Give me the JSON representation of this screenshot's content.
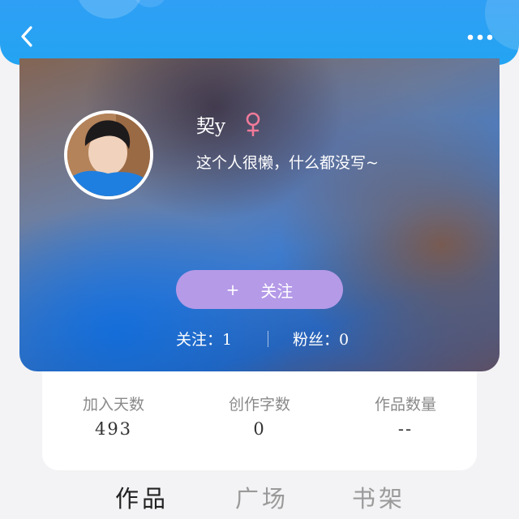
{
  "header": {
    "back_icon": "chevron-left-icon",
    "more_icon": "more-dots-icon",
    "color": "#2f9ff5"
  },
  "profile": {
    "username": "契y",
    "gender_icon": "female-symbol-icon",
    "gender_color": "#f07a9a",
    "bio": "这个人很懒，什么都没写~",
    "follow_button": {
      "icon": "+",
      "label": "关注",
      "color": "#b59ae8"
    },
    "stats": {
      "following": "关注：1",
      "fans": "粉丝：0"
    }
  },
  "summary": {
    "items": [
      {
        "label": "加入天数",
        "value": "493"
      },
      {
        "label": "创作字数",
        "value": "0"
      },
      {
        "label": "作品数量",
        "value": "--"
      }
    ]
  },
  "tabs": [
    {
      "label": "作品",
      "active": true
    },
    {
      "label": "广场",
      "active": false
    },
    {
      "label": "书架",
      "active": false
    }
  ]
}
